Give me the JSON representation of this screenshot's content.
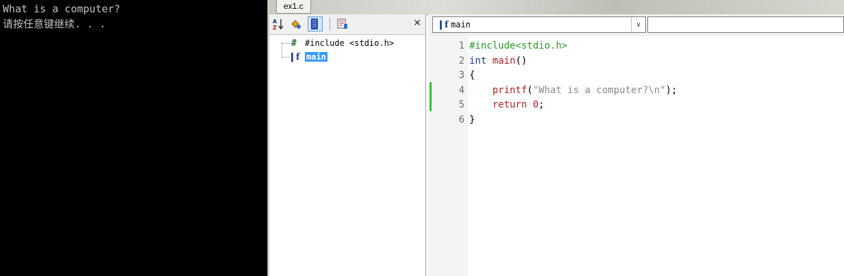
{
  "console": {
    "line1": "What is a computer?",
    "line2": "请按任意键继续. . ."
  },
  "tab": {
    "label": "ex1.c"
  },
  "classview": {
    "items": [
      {
        "label": "#include <stdio.h>",
        "icon": "hash-icon"
      },
      {
        "label": "main",
        "icon": "function-icon"
      }
    ],
    "close_glyph": "✕"
  },
  "editor_toolbar": {
    "function_combo_value": "main"
  },
  "code": [
    {
      "n": "1",
      "tokens": [
        {
          "t": "#include<stdio.h>",
          "c": "c-pre"
        }
      ]
    },
    {
      "n": "2",
      "tokens": [
        {
          "t": "int",
          "c": "c-kw"
        },
        {
          "t": " ",
          "c": "c-pl"
        },
        {
          "t": "main",
          "c": "c-fn"
        },
        {
          "t": "()",
          "c": "c-pl"
        }
      ]
    },
    {
      "n": "3",
      "tokens": [
        {
          "t": "{",
          "c": "c-pl"
        }
      ]
    },
    {
      "n": "4",
      "tokens": [
        {
          "t": "    ",
          "c": "c-pl"
        },
        {
          "t": "printf",
          "c": "c-fn"
        },
        {
          "t": "(",
          "c": "c-pl"
        },
        {
          "t": "\"What is a computer?\\n\"",
          "c": "c-str"
        },
        {
          "t": ");",
          "c": "c-pl"
        }
      ]
    },
    {
      "n": "5",
      "tokens": [
        {
          "t": "    ",
          "c": "c-pl"
        },
        {
          "t": "return",
          "c": "c-fn"
        },
        {
          "t": " ",
          "c": "c-pl"
        },
        {
          "t": "0",
          "c": "c-fn"
        },
        {
          "t": ";",
          "c": "c-pl"
        }
      ]
    },
    {
      "n": "6",
      "tokens": [
        {
          "t": "}",
          "c": "c-pl"
        }
      ]
    }
  ],
  "changed_lines": [
    "4",
    "5"
  ]
}
